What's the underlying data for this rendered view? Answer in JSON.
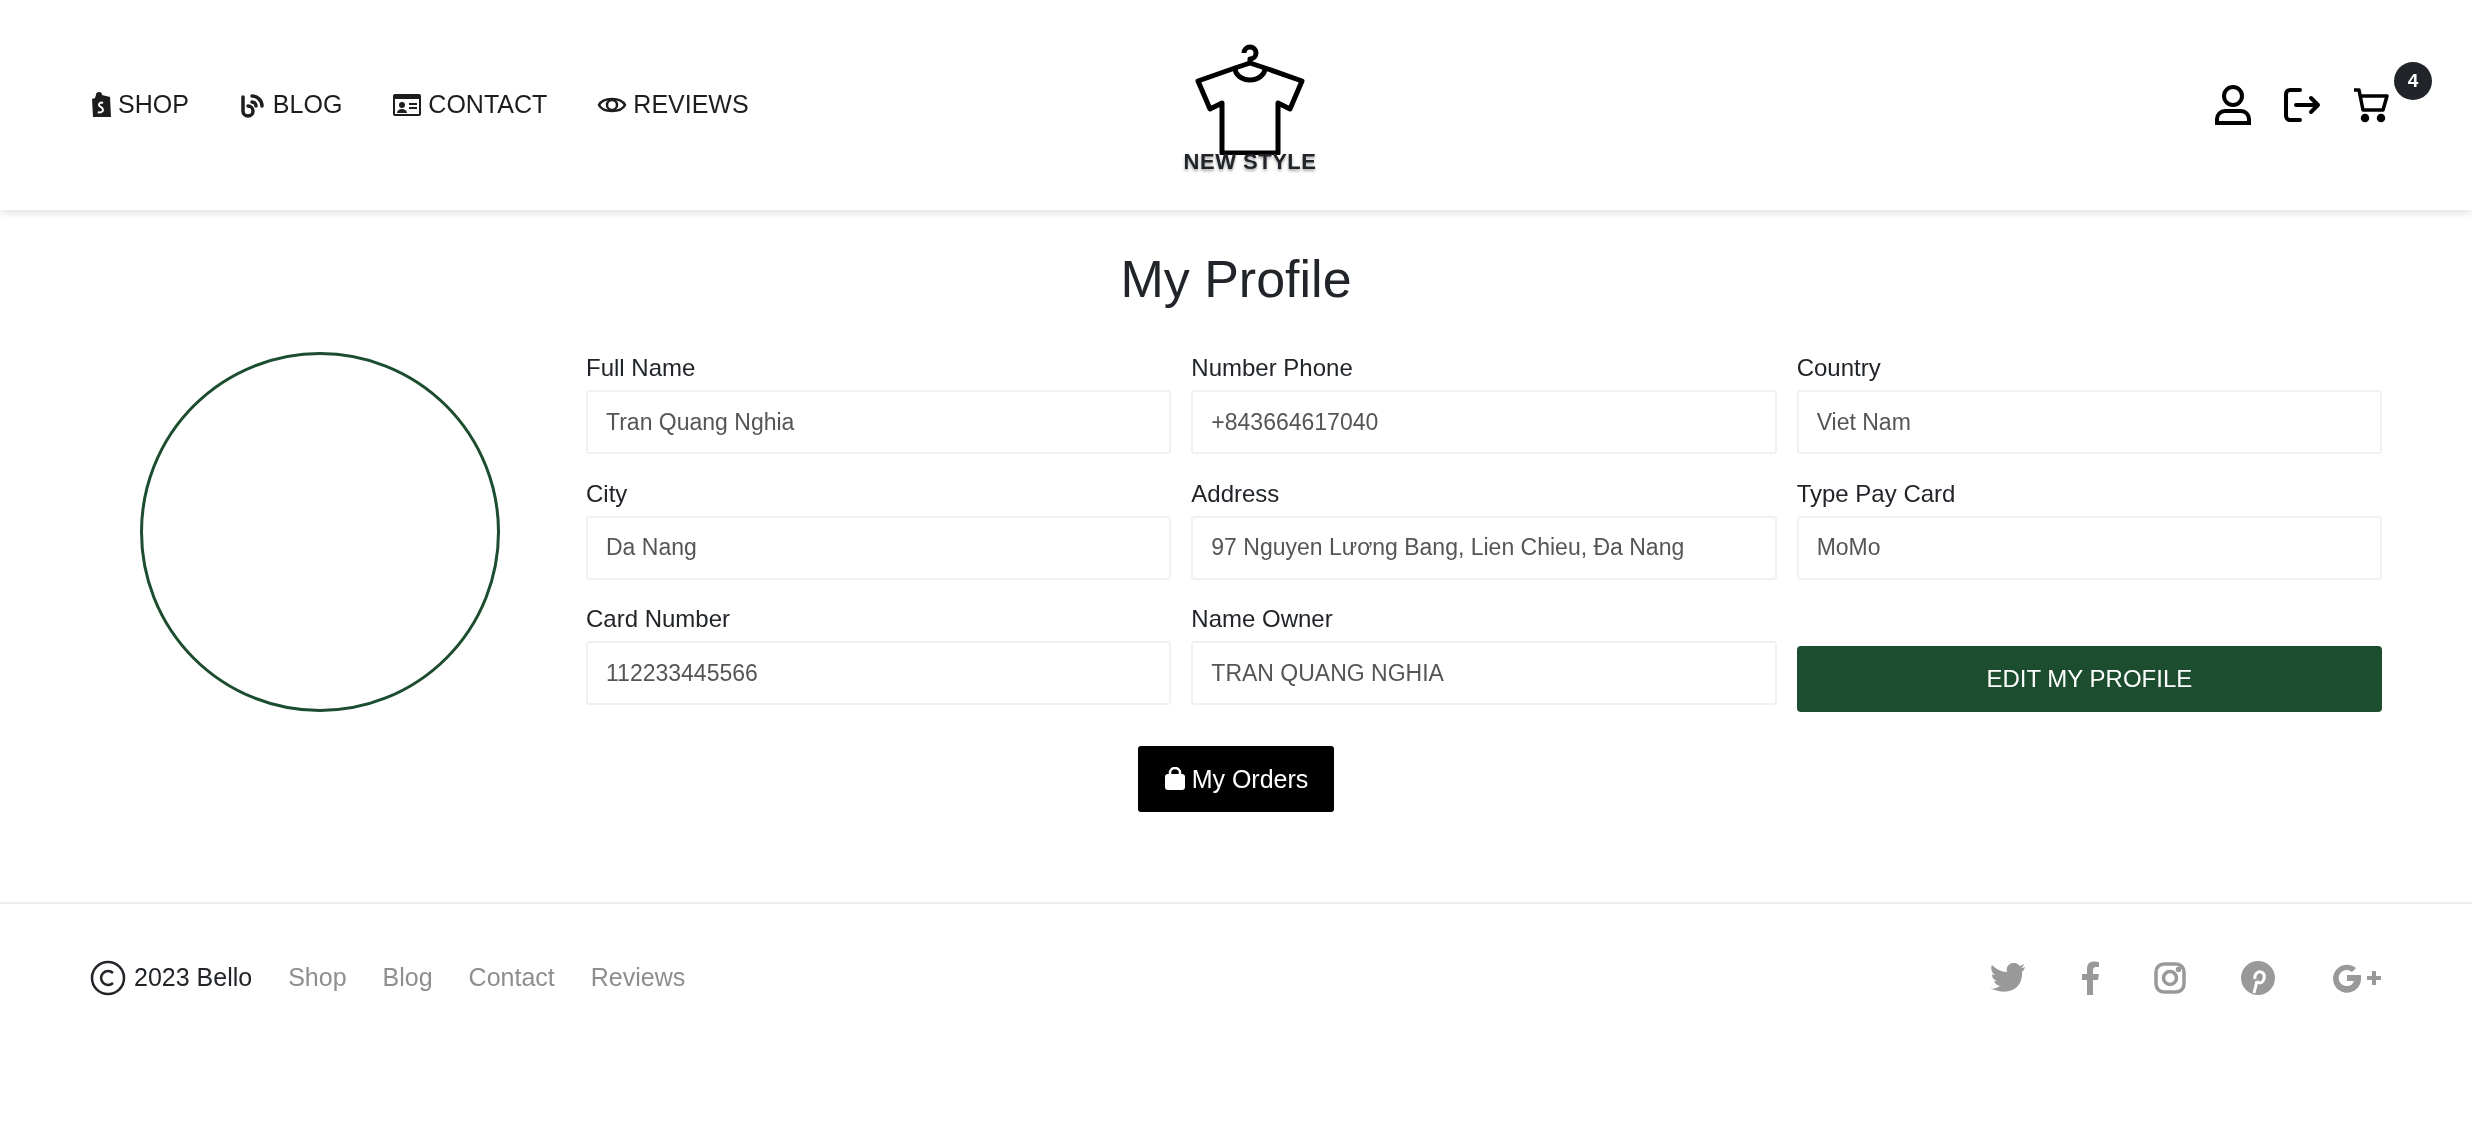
{
  "nav": {
    "links": [
      {
        "label": "SHOP"
      },
      {
        "label": "BLOG"
      },
      {
        "label": "CONTACT"
      },
      {
        "label": "REVIEWS"
      }
    ],
    "logo_text": "NEW STYLE",
    "cart_count": "4"
  },
  "title": "My Profile",
  "fields": [
    {
      "label": "Full Name",
      "value": "Tran Quang Nghia"
    },
    {
      "label": "Number Phone",
      "value": "+843664617040"
    },
    {
      "label": "Country",
      "value": "Viet Nam"
    },
    {
      "label": "City",
      "value": "Da Nang"
    },
    {
      "label": "Address",
      "value": "97 Nguyen Lương Bang, Lien Chieu, Đa Nang"
    },
    {
      "label": "Type Pay Card",
      "value": "MoMo"
    },
    {
      "label": "Card Number",
      "value": "112233445566"
    },
    {
      "label": "Name Owner",
      "value": "TRAN QUANG NGHIA"
    }
  ],
  "edit_button": "EDIT MY PROFILE",
  "orders_button": "My Orders",
  "footer": {
    "copyright": "2023 Bello",
    "links": [
      "Shop",
      "Blog",
      "Contact",
      "Reviews"
    ]
  }
}
